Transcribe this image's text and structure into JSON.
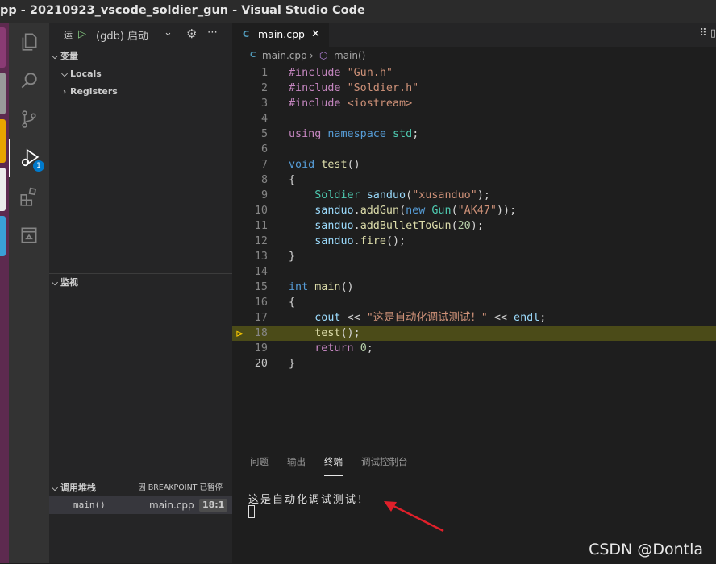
{
  "window": {
    "title": "pp - 20210923_vscode_soldier_gun - Visual Studio Code"
  },
  "debug": {
    "run_label": "运",
    "config": "(gdb) 启动",
    "sections": {
      "variables": "变量",
      "locals": "Locals",
      "registers": "Registers",
      "watch": "监视",
      "callstack": "调用堆栈",
      "callstack_status": "因 BREAKPOINT 已暂停"
    },
    "stack": [
      {
        "fn": "main()",
        "file": "main.cpp",
        "pos": "18:1"
      }
    ],
    "badge": "1"
  },
  "editor": {
    "tab": "main.cpp",
    "breadcrumb": {
      "file": "main.cpp",
      "symbol": "main()"
    },
    "current_line": 18,
    "lines": [
      {
        "n": "1",
        "code": [
          {
            "t": "#include ",
            "c": "pp"
          },
          {
            "t": "\"Gun.h\"",
            "c": "st"
          }
        ]
      },
      {
        "n": "2",
        "code": [
          {
            "t": "#include ",
            "c": "pp"
          },
          {
            "t": "\"Soldier.h\"",
            "c": "st"
          }
        ]
      },
      {
        "n": "3",
        "code": [
          {
            "t": "#include ",
            "c": "pp"
          },
          {
            "t": "<iostream>",
            "c": "st"
          }
        ]
      },
      {
        "n": "4",
        "code": []
      },
      {
        "n": "5",
        "code": [
          {
            "t": "using ",
            "c": "pp"
          },
          {
            "t": "namespace ",
            "c": "kw"
          },
          {
            "t": "std",
            "c": "ty"
          },
          {
            "t": ";",
            "c": "df"
          }
        ]
      },
      {
        "n": "6",
        "code": []
      },
      {
        "n": "7",
        "code": [
          {
            "t": "void ",
            "c": "kw"
          },
          {
            "t": "test",
            "c": "fn"
          },
          {
            "t": "()",
            "c": "df"
          }
        ]
      },
      {
        "n": "8",
        "code": [
          {
            "t": "{",
            "c": "df"
          }
        ]
      },
      {
        "n": "9",
        "code": [
          {
            "t": "    ",
            "c": "df"
          },
          {
            "t": "Soldier ",
            "c": "ty"
          },
          {
            "t": "sanduo",
            "c": "vr"
          },
          {
            "t": "(",
            "c": "df"
          },
          {
            "t": "\"xusanduo\"",
            "c": "st"
          },
          {
            "t": ");",
            "c": "df"
          }
        ]
      },
      {
        "n": "10",
        "code": [
          {
            "t": "    ",
            "c": "df"
          },
          {
            "t": "sanduo",
            "c": "vr"
          },
          {
            "t": ".",
            "c": "df"
          },
          {
            "t": "addGun",
            "c": "fn"
          },
          {
            "t": "(",
            "c": "df"
          },
          {
            "t": "new ",
            "c": "kw"
          },
          {
            "t": "Gun",
            "c": "ty"
          },
          {
            "t": "(",
            "c": "df"
          },
          {
            "t": "\"AK47\"",
            "c": "st"
          },
          {
            "t": "));",
            "c": "df"
          }
        ]
      },
      {
        "n": "11",
        "code": [
          {
            "t": "    ",
            "c": "df"
          },
          {
            "t": "sanduo",
            "c": "vr"
          },
          {
            "t": ".",
            "c": "df"
          },
          {
            "t": "addBulletToGun",
            "c": "fn"
          },
          {
            "t": "(",
            "c": "df"
          },
          {
            "t": "20",
            "c": "nu"
          },
          {
            "t": ");",
            "c": "df"
          }
        ]
      },
      {
        "n": "12",
        "code": [
          {
            "t": "    ",
            "c": "df"
          },
          {
            "t": "sanduo",
            "c": "vr"
          },
          {
            "t": ".",
            "c": "df"
          },
          {
            "t": "fire",
            "c": "fn"
          },
          {
            "t": "();",
            "c": "df"
          }
        ]
      },
      {
        "n": "13",
        "code": [
          {
            "t": "}",
            "c": "df"
          }
        ]
      },
      {
        "n": "14",
        "code": []
      },
      {
        "n": "15",
        "code": [
          {
            "t": "int ",
            "c": "kw"
          },
          {
            "t": "main",
            "c": "fn"
          },
          {
            "t": "()",
            "c": "df"
          }
        ]
      },
      {
        "n": "16",
        "code": [
          {
            "t": "{",
            "c": "df"
          }
        ]
      },
      {
        "n": "17",
        "code": [
          {
            "t": "    ",
            "c": "df"
          },
          {
            "t": "cout ",
            "c": "vr"
          },
          {
            "t": "<< ",
            "c": "df"
          },
          {
            "t": "\"这是自动化调试测试！\"",
            "c": "st"
          },
          {
            "t": " << ",
            "c": "df"
          },
          {
            "t": "endl",
            "c": "vr"
          },
          {
            "t": ";",
            "c": "df"
          }
        ]
      },
      {
        "n": "18",
        "code": [
          {
            "t": "    ",
            "c": "df"
          },
          {
            "t": "test",
            "c": "fn"
          },
          {
            "t": "();",
            "c": "df"
          }
        ]
      },
      {
        "n": "19",
        "code": [
          {
            "t": "    ",
            "c": "df"
          },
          {
            "t": "return ",
            "c": "pp"
          },
          {
            "t": "0",
            "c": "nu"
          },
          {
            "t": ";",
            "c": "df"
          }
        ]
      },
      {
        "n": "20",
        "code": [
          {
            "t": "}",
            "c": "df"
          }
        ]
      }
    ]
  },
  "panel": {
    "tabs": [
      "问题",
      "输出",
      "终端",
      "调试控制台"
    ],
    "active_tab": "终端",
    "terminal_output": "这是自动化调试测试！"
  },
  "watermark": "CSDN @Dontla",
  "colors": {
    "accent": "#007acc",
    "current_line": "#4b4b18",
    "arrow": "#e0202a"
  }
}
